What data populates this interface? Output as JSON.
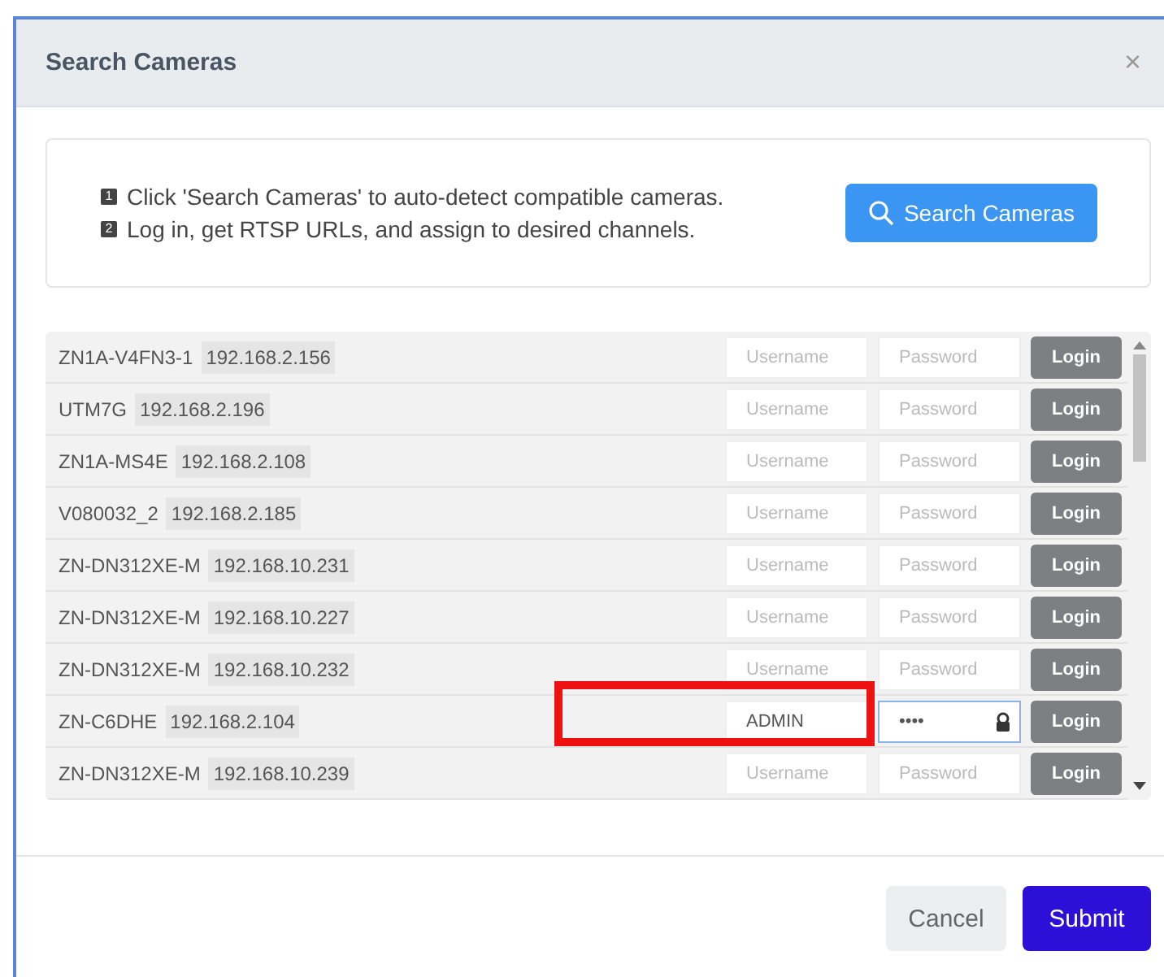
{
  "dialog": {
    "title": "Search Cameras",
    "close": "×"
  },
  "info": {
    "steps": [
      {
        "num": "1",
        "text": "Click 'Search Cameras' to auto-detect compatible cameras."
      },
      {
        "num": "2",
        "text": "Log in, get RTSP URLs, and assign to desired channels."
      }
    ],
    "search_button": "Search Cameras"
  },
  "cameras": [
    {
      "name": "ZN1A-V4FN3-1",
      "ip": "192.168.2.156",
      "username": {
        "placeholder": "Username"
      },
      "password": {
        "placeholder": "Password",
        "focused": false
      },
      "login": "Login",
      "highlighted": false
    },
    {
      "name": "UTM7G",
      "ip": "192.168.2.196",
      "username": {
        "placeholder": "Username"
      },
      "password": {
        "placeholder": "Password",
        "focused": false
      },
      "login": "Login",
      "highlighted": false
    },
    {
      "name": "ZN1A-MS4E",
      "ip": "192.168.2.108",
      "username": {
        "placeholder": "Username"
      },
      "password": {
        "placeholder": "Password",
        "focused": false
      },
      "login": "Login",
      "highlighted": false
    },
    {
      "name": "V080032_2",
      "ip": "192.168.2.185",
      "username": {
        "placeholder": "Username"
      },
      "password": {
        "placeholder": "Password",
        "focused": false
      },
      "login": "Login",
      "highlighted": false
    },
    {
      "name": "ZN-DN312XE-M",
      "ip": "192.168.10.231",
      "username": {
        "placeholder": "Username"
      },
      "password": {
        "placeholder": "Password",
        "focused": false
      },
      "login": "Login",
      "highlighted": false
    },
    {
      "name": "ZN-DN312XE-M",
      "ip": "192.168.10.227",
      "username": {
        "placeholder": "Username"
      },
      "password": {
        "placeholder": "Password",
        "focused": false
      },
      "login": "Login",
      "highlighted": false
    },
    {
      "name": "ZN-DN312XE-M",
      "ip": "192.168.10.232",
      "username": {
        "placeholder": "Username"
      },
      "password": {
        "placeholder": "Password",
        "focused": false
      },
      "login": "Login",
      "highlighted": false
    },
    {
      "name": "ZN-C6DHE",
      "ip": "192.168.2.104",
      "username": {
        "value": "ADMIN"
      },
      "password": {
        "value": "••••",
        "focused": true
      },
      "login": "Login",
      "highlighted": true
    },
    {
      "name": "ZN-DN312XE-M",
      "ip": "192.168.10.239",
      "username": {
        "placeholder": "Username"
      },
      "password": {
        "placeholder": "Password",
        "focused": false
      },
      "login": "Login",
      "highlighted": false
    }
  ],
  "buttons": {
    "cancel": "Cancel",
    "submit": "Submit"
  }
}
